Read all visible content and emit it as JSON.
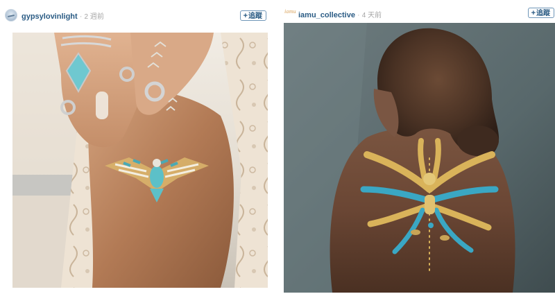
{
  "posts": [
    {
      "username": "gypsylovinlight",
      "time": "2 週前",
      "follow_label": "追蹤",
      "photo": {
        "palette": [
          "#c99a78",
          "#e9dcc8",
          "#5cc0c8",
          "#d8b36a"
        ]
      }
    },
    {
      "username": "iamu_collective",
      "avatar_text": "iamu",
      "time": "4 天前",
      "follow_label": "追蹤",
      "photo": {
        "palette": [
          "#5a6b6e",
          "#6b4a37",
          "#3aa7c4",
          "#d9b35a"
        ]
      }
    }
  ]
}
